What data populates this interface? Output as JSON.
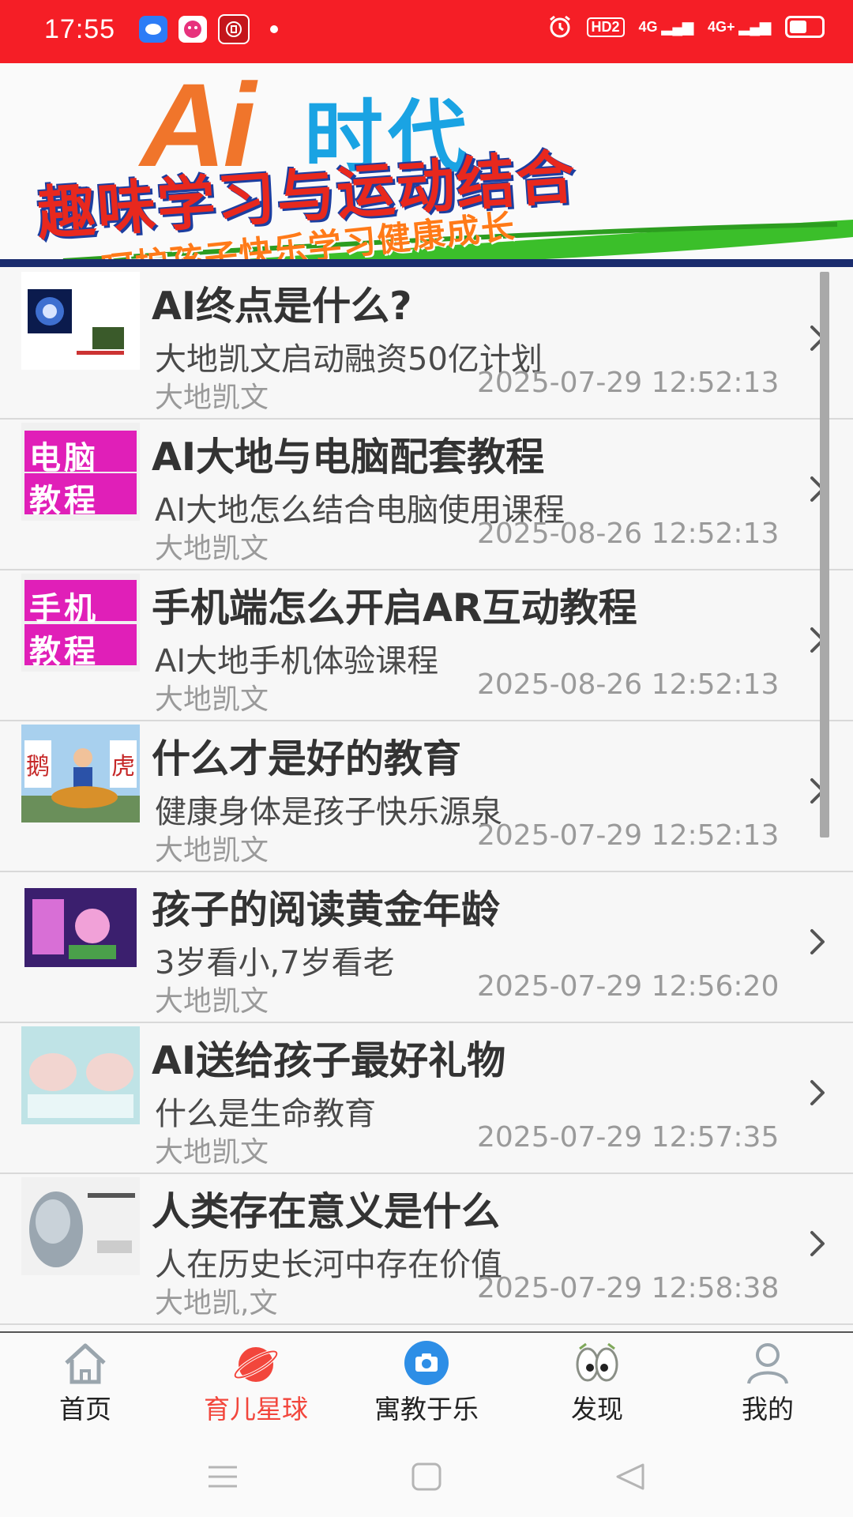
{
  "status_bar": {
    "time": "17:55",
    "hd_badge": "HD2",
    "signal1": "4G",
    "signal2": "4G+",
    "battery_level": 0.55
  },
  "banner": {
    "ai_text": "Ai",
    "era_text": "时代",
    "headline": "趣味学习与运动结合",
    "subline": "呵护孩子快乐学习健康成长"
  },
  "articles": [
    {
      "title": "AI终点是什么?",
      "subtitle": "大地凯文启动融资50亿计划",
      "author": "大地凯文",
      "date": "2025-07-29 12:52:13",
      "thumb_text": []
    },
    {
      "title": "AI大地与电脑配套教程",
      "subtitle": "AI大地怎么结合电脑使用课程",
      "author": "大地凯文",
      "date": "2025-08-26 12:52:13",
      "thumb_text": [
        "电脑",
        "教程"
      ]
    },
    {
      "title": "手机端怎么开启AR互动教程",
      "subtitle": "AI大地手机体验课程",
      "author": "大地凯文",
      "date": "2025-08-26 12:52:13",
      "thumb_text": [
        "手机",
        "教程"
      ]
    },
    {
      "title": "什么才是好的教育",
      "subtitle": "健康身体是孩子快乐源泉",
      "author": "大地凯文",
      "date": "2025-07-29 12:52:13",
      "thumb_text": [
        "鹅",
        "虎"
      ]
    },
    {
      "title": "孩子的阅读黄金年龄",
      "subtitle": "3岁看小,7岁看老",
      "author": "大地凯文",
      "date": "2025-07-29 12:56:20",
      "thumb_text": []
    },
    {
      "title": "AI送给孩子最好礼物",
      "subtitle": "什么是生命教育",
      "author": "大地凯文",
      "date": "2025-07-29 12:57:35",
      "thumb_text": []
    },
    {
      "title": "人类存在意义是什么",
      "subtitle": "人在历史长河中存在价值",
      "author": "大地凯,文",
      "date": "2025-07-29 12:58:38",
      "thumb_text": []
    }
  ],
  "bottom_nav": [
    {
      "label": "首页",
      "icon": "home-icon",
      "active": false
    },
    {
      "label": "育儿星球",
      "icon": "planet-icon",
      "active": true
    },
    {
      "label": "寓教于乐",
      "icon": "camera-icon",
      "active": false
    },
    {
      "label": "发现",
      "icon": "eyes-icon",
      "active": false
    },
    {
      "label": "我的",
      "icon": "user-icon",
      "active": false
    }
  ],
  "colors": {
    "status_bar": "#f51e26",
    "active_tab": "#f2463c",
    "title_text": "#333333",
    "meta_text": "#9a9a9a"
  }
}
